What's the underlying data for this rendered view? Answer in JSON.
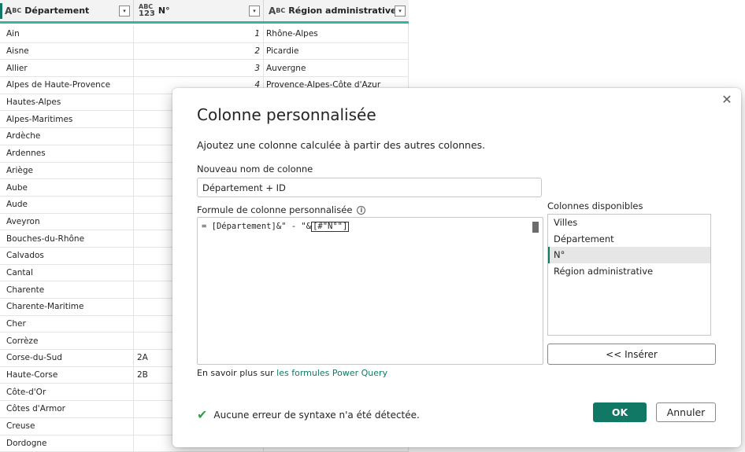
{
  "grid": {
    "columns": [
      {
        "type": "ABC",
        "label": "Département"
      },
      {
        "type": "ABC123",
        "label": "N°"
      },
      {
        "type": "ABC",
        "label": "Région administrative"
      }
    ],
    "type_labels": {
      "abc_a": "A",
      "abc_bc": "BC",
      "num_top": "ABC",
      "num_bottom": "123"
    },
    "dropdown_glyph": "▾",
    "rows": [
      {
        "dep": "Ain",
        "num": "1",
        "region": "Rhône-Alpes"
      },
      {
        "dep": "Aisne",
        "num": "2",
        "region": "Picardie"
      },
      {
        "dep": "Allier",
        "num": "3",
        "region": "Auvergne"
      },
      {
        "dep": "Alpes de Haute-Provence",
        "num": "4",
        "region": "Provence-Alpes-Côte d'Azur"
      },
      {
        "dep": "Hautes-Alpes",
        "num": "",
        "region": ""
      },
      {
        "dep": "Alpes-Maritimes",
        "num": "",
        "region": ""
      },
      {
        "dep": "Ardèche",
        "num": "",
        "region": ""
      },
      {
        "dep": "Ardennes",
        "num": "",
        "region": ""
      },
      {
        "dep": "Ariège",
        "num": "",
        "region": ""
      },
      {
        "dep": "Aube",
        "num": "",
        "region": ""
      },
      {
        "dep": "Aude",
        "num": "",
        "region": ""
      },
      {
        "dep": "Aveyron",
        "num": "",
        "region": ""
      },
      {
        "dep": "Bouches-du-Rhône",
        "num": "",
        "region": ""
      },
      {
        "dep": "Calvados",
        "num": "",
        "region": ""
      },
      {
        "dep": "Cantal",
        "num": "",
        "region": ""
      },
      {
        "dep": "Charente",
        "num": "",
        "region": ""
      },
      {
        "dep": "Charente-Maritime",
        "num": "",
        "region": ""
      },
      {
        "dep": "Cher",
        "num": "",
        "region": ""
      },
      {
        "dep": "Corrèze",
        "num": "",
        "region": ""
      },
      {
        "dep": "Corse-du-Sud",
        "num": "2A",
        "region": ""
      },
      {
        "dep": "Haute-Corse",
        "num": "2B",
        "region": ""
      },
      {
        "dep": "Côte-d'Or",
        "num": "",
        "region": ""
      },
      {
        "dep": "Côtes d'Armor",
        "num": "",
        "region": ""
      },
      {
        "dep": "Creuse",
        "num": "",
        "region": ""
      },
      {
        "dep": "Dordogne",
        "num": "",
        "region": ""
      }
    ]
  },
  "dialog": {
    "close_glyph": "✕",
    "title": "Colonne personnalisée",
    "subtitle": "Ajoutez une colonne calculée à partir des autres colonnes.",
    "name_label": "Nouveau nom de colonne",
    "name_value": "Département + ID",
    "formula_label": "Formule de colonne personnalisée",
    "info_glyph": "i",
    "formula_text": "= [Département]&\" - \"&",
    "formula_cursor_text": "[#\"N°\"]",
    "available_label": "Colonnes disponibles",
    "available_columns": [
      "Villes",
      "Département",
      "N°",
      "Région administrative"
    ],
    "selected_index": 2,
    "insert_label": "<< Insérer",
    "learn_prefix": "En savoir plus sur ",
    "learn_link": "les formules Power Query",
    "status_icon": "✔",
    "status_text": "Aucune erreur de syntaxe n'a été détectée.",
    "ok_label": "OK",
    "cancel_label": "Annuler"
  },
  "colors": {
    "accent": "#117865",
    "header_underline": "#33b5a2",
    "check": "#3a9d4f"
  }
}
